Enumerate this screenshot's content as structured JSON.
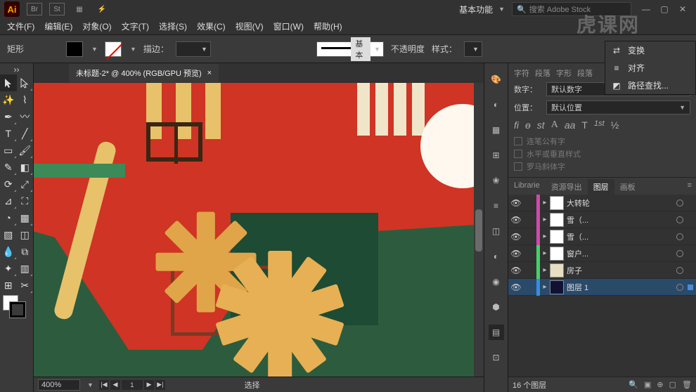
{
  "app": {
    "logo": "Ai",
    "workspace": "基本功能",
    "search_placeholder": "搜索 Adobe Stock"
  },
  "menu": [
    "文件(F)",
    "编辑(E)",
    "对象(O)",
    "文字(T)",
    "选择(S)",
    "效果(C)",
    "视图(V)",
    "窗口(W)",
    "帮助(H)"
  ],
  "control": {
    "shape_label": "矩形",
    "stroke_label": "描边：",
    "brush_basic": "基本",
    "opacity_label": "不透明度",
    "style_label": "样式："
  },
  "doc": {
    "tab_title": "未标题-2* @ 400% (RGB/GPU 预览)",
    "zoom": "400%",
    "status_center": "选择"
  },
  "submenu": {
    "items": [
      {
        "icon": "⇄",
        "label": "变换"
      },
      {
        "icon": "≡",
        "label": "对齐"
      },
      {
        "icon": "◩",
        "label": "路径查找..."
      }
    ]
  },
  "char_panel": {
    "tabs": [
      "字符",
      "段落",
      "字形",
      "段落"
    ],
    "number_label": "数字：",
    "number_value": "默认数字",
    "position_label": "位置：",
    "position_value": "默认位置",
    "ot_glyphs": [
      "fi",
      "ɵ",
      "st",
      "A",
      "aa",
      "T",
      "1st",
      "½"
    ],
    "checks": [
      "连笔公有字",
      "水平或垂直样式",
      "罗马斜体字"
    ]
  },
  "layers": {
    "tabs": [
      "Librarie",
      "资源导出",
      "图层",
      "画板"
    ],
    "items": [
      {
        "color": "#d04aa8",
        "thumb": "#fff",
        "name": "大转轮",
        "sel": false,
        "icon": "gear"
      },
      {
        "color": "#d04aa8",
        "thumb": "#fff",
        "name": "雪（...",
        "sel": false
      },
      {
        "color": "#d04aa8",
        "thumb": "#fff",
        "name": "雪（...",
        "sel": false
      },
      {
        "color": "#46d06a",
        "thumb": "#fff",
        "name": "窗户...",
        "sel": false
      },
      {
        "color": "#46d06a",
        "thumb": "#e8dec2",
        "name": "房子",
        "sel": false
      },
      {
        "color": "#3a8ae0",
        "thumb": "#113",
        "name": "图层 1",
        "sel": true
      }
    ],
    "count_label": "16 个图层"
  },
  "watermark": "虎课网"
}
